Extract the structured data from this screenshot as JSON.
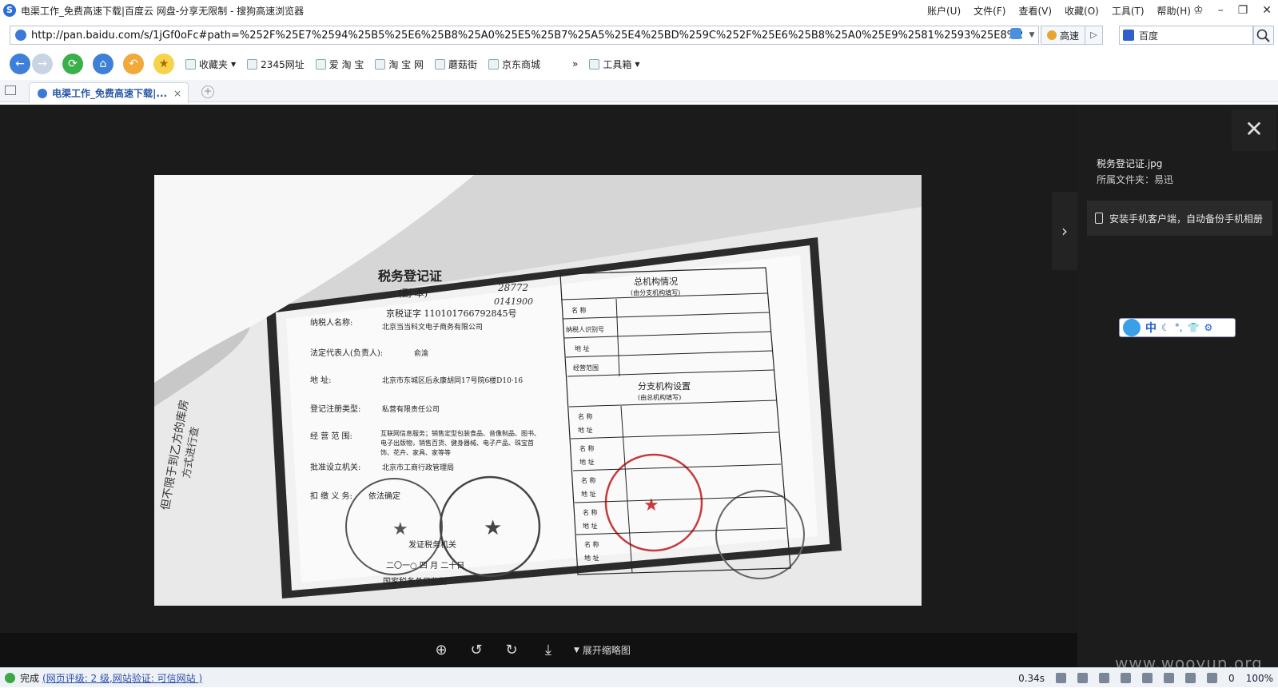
{
  "window": {
    "title": "电渠工作_免费高速下载|百度云 网盘-分享无限制 - 搜狗高速浏览器",
    "menus": [
      "账户(U)",
      "文件(F)",
      "查看(V)",
      "收藏(O)",
      "工具(T)",
      "帮助(H)"
    ]
  },
  "address": {
    "url": "http://pan.baidu.com/s/1jGf0oFc#path=%252F%25E7%2594%25B5%25E6%25B8%25A0%25E5%25B7%25A5%25E4%25BD%259C%252F%25E6%25B8%25A0%25E9%2581%2593%25E8%25",
    "fast_label": "高速",
    "search_engine": "百度"
  },
  "bookmarks": {
    "favorites_label": "收藏夹",
    "items": [
      "2345网址",
      "爱 淘 宝",
      "淘 宝 网",
      "蘑菇街",
      "京东商城"
    ],
    "more": "»",
    "toolbox_label": "工具箱"
  },
  "tab": {
    "label": "电渠工作_免费高速下载|...",
    "close": "×"
  },
  "viewer": {
    "file_name": "税务登记证.jpg",
    "folder_line": "所属文件夹：易迅",
    "install_text": "安装手机客户端，自动备份手机相册",
    "expand_thumbs": "展开缩略图",
    "ime_label": "中"
  },
  "document": {
    "title": "税务登记证",
    "subtitle": "(副 本)",
    "handwritten_1": "28772",
    "handwritten_2": "0141900",
    "cert_no": "京税证字 110101766792845号",
    "rows": [
      {
        "label": "纳税人名称:",
        "value": "北京当当科文电子商务有限公司"
      },
      {
        "label": "法定代表人(负责人):",
        "value": "俞渝"
      },
      {
        "label": "地 址:",
        "value": "北京市东城区后永康胡同17号院6楼D10·16"
      },
      {
        "label": "登记注册类型:",
        "value": "私营有限责任公司"
      },
      {
        "label": "经 营 范 围:",
        "value": "互联网信息服务；销售定型包装食品、音像制品、图书、电子出版物，销售百货、健身器械、电子产品、珠宝首饰、花卉、家具、家等等"
      },
      {
        "label": "批准设立机关:",
        "value": "北京市工商行政管理局"
      },
      {
        "label": "扣 缴 义 务:",
        "value": "依法确定"
      }
    ],
    "issuer_line": "发证税务机关",
    "date_line": "二〇一○ 四 月 二十日",
    "supervised": "国家税务总局监制",
    "right_header": "总机构情况",
    "right_sub": "(由分支机构填写)",
    "right_rows": [
      "名 称",
      "纳税人识别号",
      "地 址",
      "经营范围"
    ],
    "branch_header": "分支机构设置",
    "branch_sub": "(由总机构填写)",
    "branch_rows": [
      "名 称",
      "地 址",
      "名 称",
      "地 址",
      "名 称",
      "地 址",
      "名 称",
      "地 址",
      "名 称",
      "地 址"
    ],
    "side_text": "但不限于到乙方的库房",
    "side_text_2": "方式进行查"
  },
  "status": {
    "done": "完成",
    "rating": "(网页评级: 2 级,网站验证: 可信网站 )",
    "speed": "0.34s",
    "count": "0",
    "zoom": "100%"
  },
  "watermark": "www.wooyun.org"
}
